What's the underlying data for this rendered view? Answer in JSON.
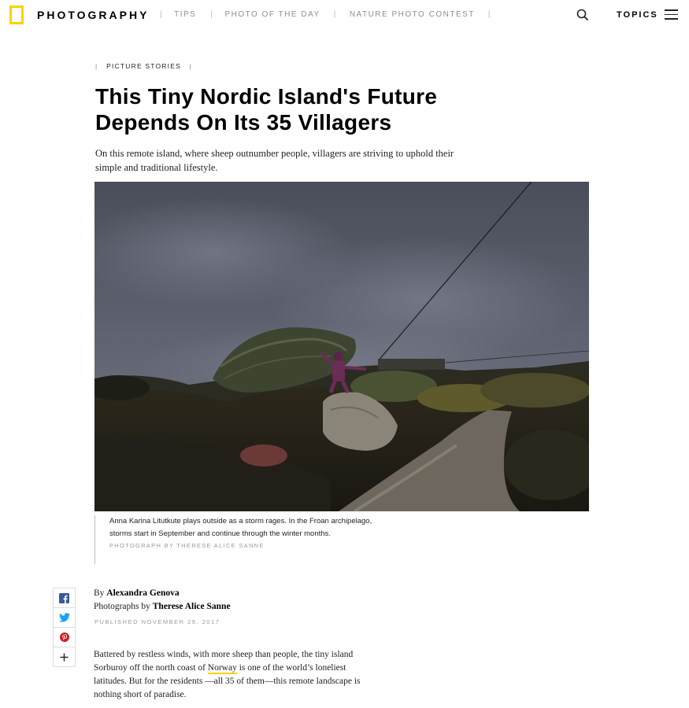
{
  "header": {
    "brand": "PHOTOGRAPHY",
    "nav": [
      "TIPS",
      "PHOTO OF THE DAY",
      "NATURE PHOTO CONTEST"
    ],
    "separator": "|",
    "topics_label": "TOPICS",
    "icons": {
      "search": "search-icon",
      "menu": "hamburger-menu-icon",
      "logo": "yellow-border-logo"
    },
    "logo_color": "#ffd200"
  },
  "article": {
    "kicker": "PICTURE STORIES",
    "headline_line1": "This Tiny Nordic Island's Future",
    "headline_line2": "Depends On Its 35 Villagers",
    "dek": "On this remote island, where sheep outnumber people, villagers are striving to uphold their simple and traditional lifestyle.",
    "caption": "Anna Karina Litutkute plays outside as a storm rages. In the Froan archipelago, storms start in September and continue through the winter months.",
    "photo_credit": "PHOTOGRAPH BY THERESE ALICE SANNE",
    "byline_prefix": "By",
    "author": "Alexandra Genova",
    "photos_prefix": "Photographs by",
    "photographer": "Therese Alice Sanne",
    "published": "PUBLISHED NOVEMBER 29, 2017",
    "body_part1": "Battered by restless winds, with more sheep than people, the tiny island Sorburoy off the north coast of",
    "body_link": "Norway",
    "body_part2": "is one of the world’s loneliest latitudes. But for the residents —all 35 of them—this remote landscape is nothing short of paradise."
  },
  "share": {
    "icons": [
      "facebook-icon",
      "twitter-icon",
      "pinterest-icon",
      "plus-icon"
    ],
    "colors": {
      "facebook": "#3b5998",
      "twitter": "#1da1f2",
      "pinterest": "#cb2027"
    }
  }
}
